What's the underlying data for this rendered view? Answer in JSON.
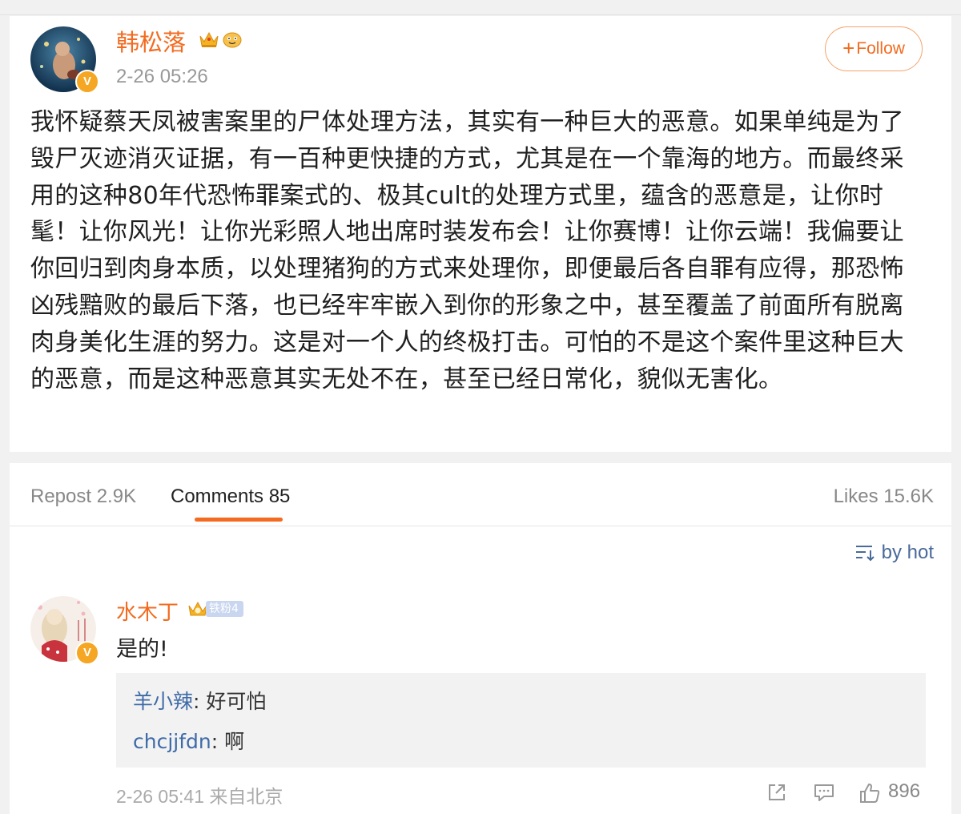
{
  "post": {
    "username": "韩松落",
    "timestamp": "2-26 05:26",
    "follow_label": "Follow",
    "follow_plus": "+",
    "text": "我怀疑蔡天凤被害案里的尸体处理方法，其实有一种巨大的恶意。如果单纯是为了毁尸灭迹消灭证据，有一百种更快捷的方式，尤其是在一个靠海的地方。而最终采用的这种80年代恐怖罪案式的、极其cult的处理方式里，蕴含的恶意是，让你时髦！让你风光！让你光彩照人地出席时装发布会！让你赛博！让你云端！我偏要让你回归到肉身本质，以处理猪狗的方式来处理你，即便最后各自罪有应得，那恐怖凶残黯败的最后下落，也已经牢牢嵌入到你的形象之中，甚至覆盖了前面所有脱离肉身美化生涯的努力。这是对一个人的终极打击。可怕的不是这个案件里这种巨大的恶意，而是这种恶意其实无处不在，甚至已经日常化，貌似无害化。",
    "verified_mark": "V",
    "icons": [
      "crown-icon",
      "emoji-badge-icon"
    ]
  },
  "tabs": {
    "repost": "Repost 2.9K",
    "comments": "Comments 85",
    "likes": "Likes 15.6K",
    "active": "comments"
  },
  "sort": {
    "label": "by hot",
    "icon": "sort-icon"
  },
  "comment": {
    "username": "水木丁",
    "fan_badge": "铁粉4",
    "verified_mark": "V",
    "text": "是的!",
    "replies": [
      {
        "user": "羊小辣",
        "separator": ": ",
        "text": "好可怕"
      },
      {
        "user": "chcjjfdn",
        "separator": ": ",
        "text": "啊"
      }
    ],
    "meta": "2-26 05:41 来自北京",
    "likes": "896",
    "actions": [
      "share-icon",
      "comment-icon",
      "like-icon"
    ]
  },
  "colors": {
    "accent": "#f36b20",
    "link": "#3f6aa8",
    "verified": "#f5a623",
    "muted": "#999999"
  }
}
